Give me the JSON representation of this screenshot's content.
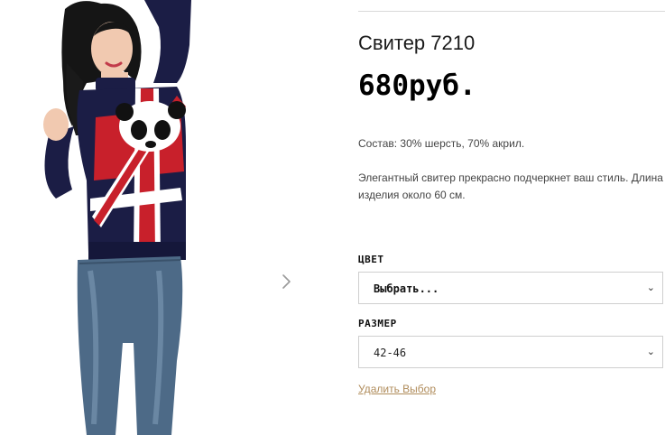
{
  "product": {
    "title": "Свитер 7210",
    "price": "680руб.",
    "composition": "Состав: 30% шерсть, 70% акрил.",
    "description": "Элегантный свитер прекрасно подчеркнет ваш стиль. Длина изделия около 60 см."
  },
  "gallery": {
    "next_icon": "chevron-right-icon",
    "image_subject": "model-in-union-jack-panda-sweater"
  },
  "options": {
    "color": {
      "label": "ЦВЕТ",
      "selected": "Выбрать..."
    },
    "size": {
      "label": "РАЗМЕР",
      "selected": "42-46"
    },
    "dropdown_icon": "chevron-down-icon",
    "reset_label": "Удалить Выбор"
  },
  "colors": {
    "link": "#b08c5b",
    "sweater_navy": "#1b1d45",
    "sweater_red": "#c8202b"
  }
}
